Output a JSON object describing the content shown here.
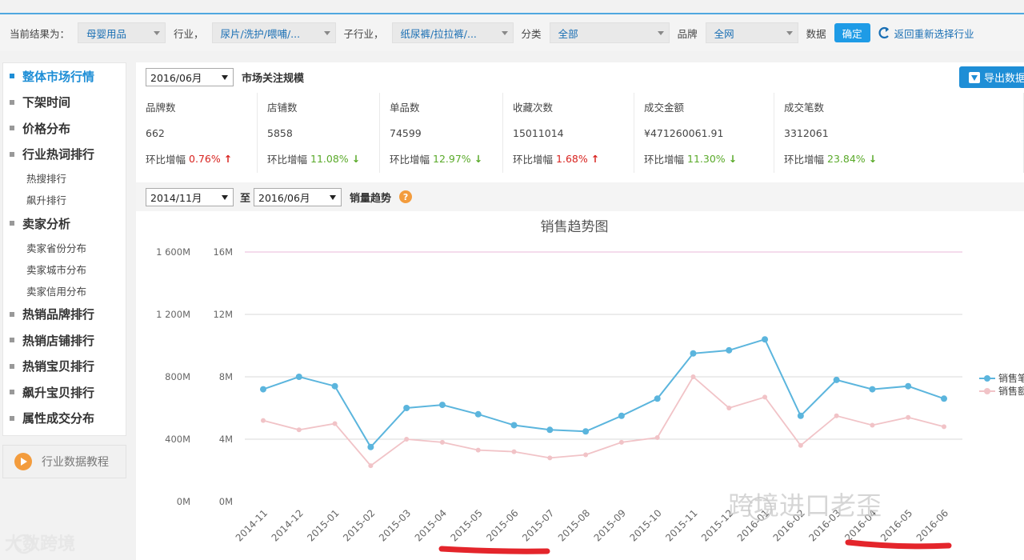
{
  "filters": {
    "current_result_label": "当前结果为：",
    "category_value": "母婴用品",
    "industry_label": "行业，",
    "industry_value": "尿片/洗护/喂哺/...",
    "subindustry_label": "子行业，",
    "subindustry_value": "纸尿裤/拉拉裤/...",
    "classify_label": "分类",
    "classify_value": "全部",
    "brand_label": "品牌",
    "brand_value": "全网",
    "data_label": "数据",
    "confirm_label": "确定",
    "back_label": "返回重新选择行业"
  },
  "sidebar": {
    "items": [
      {
        "label": "整体市场行情",
        "type": "main",
        "active": true
      },
      {
        "label": "下架时间",
        "type": "main"
      },
      {
        "label": "价格分布",
        "type": "main"
      },
      {
        "label": "行业热词排行",
        "type": "main"
      },
      {
        "label": "热搜排行",
        "type": "sub"
      },
      {
        "label": "飙升排行",
        "type": "sub"
      },
      {
        "label": "卖家分析",
        "type": "main"
      },
      {
        "label": "卖家省份分布",
        "type": "sub"
      },
      {
        "label": "卖家城市分布",
        "type": "sub"
      },
      {
        "label": "卖家信用分布",
        "type": "sub"
      },
      {
        "label": "热销品牌排行",
        "type": "main"
      },
      {
        "label": "热销店铺排行",
        "type": "main"
      },
      {
        "label": "热销宝贝排行",
        "type": "main"
      },
      {
        "label": "飙升宝贝排行",
        "type": "main"
      },
      {
        "label": "属性成交分布",
        "type": "main"
      }
    ],
    "tutorial_label": "行业数据教程"
  },
  "scale": {
    "month_value": "2016/06月",
    "title": "市场关注规模",
    "export_label": "导出数据"
  },
  "stats": [
    {
      "label": "品牌数",
      "value": "662",
      "change_prefix": "环比增幅",
      "change": "0.76%",
      "dir": "up"
    },
    {
      "label": "店铺数",
      "value": "5858",
      "change_prefix": "环比增幅",
      "change": "11.08%",
      "dir": "down"
    },
    {
      "label": "单品数",
      "value": "74599",
      "change_prefix": "环比增幅",
      "change": "12.97%",
      "dir": "down"
    },
    {
      "label": "收藏次数",
      "value": "15011014",
      "change_prefix": "环比增幅",
      "change": "1.68%",
      "dir": "up"
    },
    {
      "label": "成交金额",
      "value": "¥471260061.91",
      "change_prefix": "环比增幅",
      "change": "11.30%",
      "dir": "down"
    },
    {
      "label": "成交笔数",
      "value": "3312061",
      "change_prefix": "环比增幅",
      "change": "23.84%",
      "dir": "down"
    }
  ],
  "trend": {
    "from_value": "2014/11月",
    "to_label": "至",
    "to_value": "2016/06月",
    "title": "销量趋势",
    "help": "?"
  },
  "colors": {
    "series1": "#5bb5dd",
    "series2": "#f1c3c7",
    "grid_top": "#e8b7d9",
    "accent": "#1e8ed6"
  },
  "chart_data": {
    "type": "line",
    "title": "销售趋势图",
    "x": [
      "2014-11",
      "2014-12",
      "2015-01",
      "2015-02",
      "2015-03",
      "2015-04",
      "2015-05",
      "2015-06",
      "2015-07",
      "2015-08",
      "2015-09",
      "2015-10",
      "2015-11",
      "2015-12",
      "2016-01",
      "2016-02",
      "2016-03",
      "2016-04",
      "2016-05",
      "2016-06"
    ],
    "left_axis_ticks": [
      "0M",
      "400M",
      "800M",
      "1 200M",
      "1 600M"
    ],
    "right_axis_ticks": [
      "0M",
      "4M",
      "8M",
      "12M",
      "16M"
    ],
    "ylim_left": [
      0,
      1600
    ],
    "ylim_right": [
      0,
      16
    ],
    "series": [
      {
        "name": "销售笔",
        "axis": "right",
        "values": [
          7.2,
          8.0,
          7.4,
          3.5,
          6.0,
          6.2,
          5.6,
          4.9,
          4.6,
          4.5,
          5.5,
          6.6,
          9.5,
          9.7,
          10.4,
          5.5,
          7.8,
          7.2,
          7.4,
          6.6
        ]
      },
      {
        "name": "销售额",
        "axis": "left",
        "values": [
          520,
          460,
          500,
          230,
          400,
          380,
          330,
          320,
          280,
          300,
          380,
          410,
          800,
          600,
          670,
          360,
          550,
          490,
          540,
          480
        ]
      }
    ],
    "legend": "right",
    "grid": true
  },
  "watermarks": {
    "right": "跨境进口老歪",
    "left": "大数跨境"
  }
}
